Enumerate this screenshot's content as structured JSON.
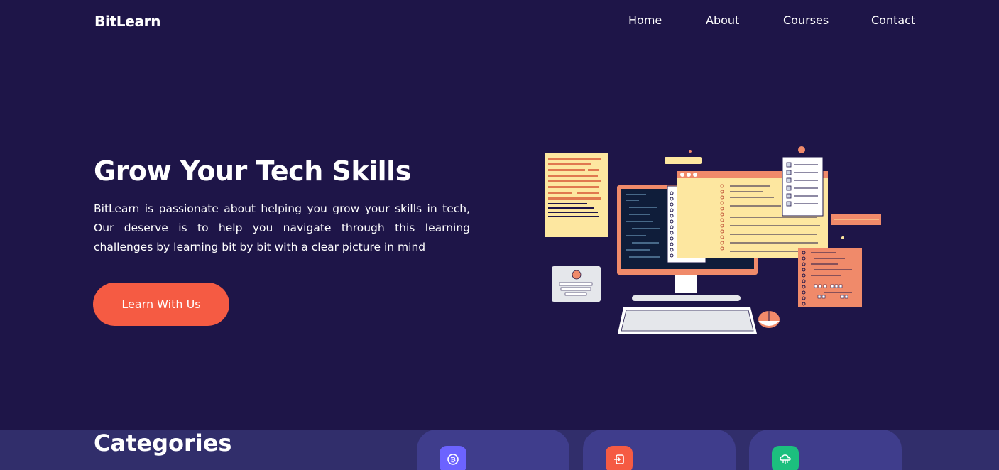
{
  "nav": {
    "logo": "BitLearn",
    "links": [
      "Home",
      "About",
      "Courses",
      "Contact"
    ]
  },
  "hero": {
    "title": "Grow Your Tech Skills",
    "description": "BitLearn is passionate about helping you grow your skills in tech, Our deserve is to help you navigate through this learning challenges by learning bit by bit with a clear picture in mind",
    "cta_label": "Learn With Us"
  },
  "categories": {
    "title": "Categories",
    "cards": [
      {
        "icon": "bitcoin-icon",
        "color": "#6c63ff"
      },
      {
        "icon": "login-icon",
        "color": "#f55b43"
      },
      {
        "icon": "cloud-network-icon",
        "color": "#1cbf7e"
      }
    ]
  },
  "colors": {
    "background": "#1e1548",
    "accent": "#f55b43",
    "band": "#312e6b",
    "card": "#3f3d8c"
  }
}
